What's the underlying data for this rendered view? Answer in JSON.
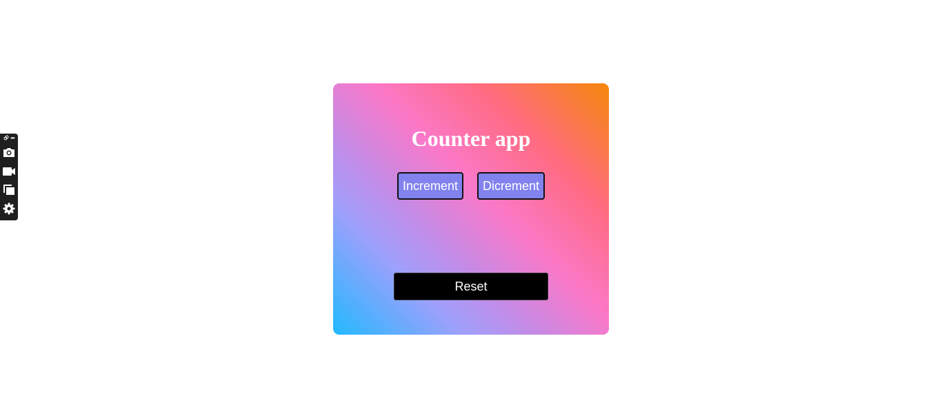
{
  "toolbar": {
    "icons": [
      "link-icon",
      "more-icon",
      "camera-icon",
      "video-icon",
      "copy-icon",
      "settings-icon"
    ]
  },
  "app": {
    "title": "Counter app",
    "increment_label": "Increment",
    "decrement_label": "Dicrement",
    "count_value": "",
    "reset_label": "Reset"
  },
  "colors": {
    "gradient": [
      "#f5870a",
      "#ff6b81",
      "#fb78c8",
      "#9fa0fc",
      "#22b9ff"
    ],
    "button_bg": "#8282ee",
    "reset_bg": "#000000"
  }
}
